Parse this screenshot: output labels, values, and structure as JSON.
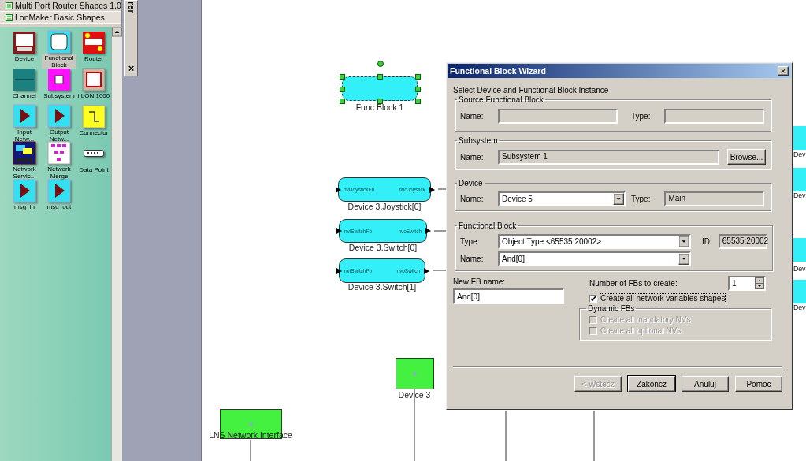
{
  "stencil": {
    "sections": [
      {
        "title": "Multi Port Router Shapes 1.0",
        "selected": false
      },
      {
        "title": "LonMaker Basic Shapes",
        "selected": true
      }
    ],
    "shapes": [
      {
        "label": "Device",
        "kind": "device",
        "selected": false
      },
      {
        "label": "Functional Block",
        "kind": "fb",
        "selected": true
      },
      {
        "label": "Router",
        "kind": "router",
        "selected": false
      },
      {
        "label": "Channel",
        "kind": "channel",
        "selected": false
      },
      {
        "label": "Subsystem",
        "kind": "subsystem",
        "selected": false
      },
      {
        "label": "i.LON 1000",
        "kind": "ilon",
        "selected": false
      },
      {
        "label": "Input Netw...",
        "kind": "input",
        "selected": false
      },
      {
        "label": "Output Netw...",
        "kind": "output",
        "selected": false
      },
      {
        "label": "Connector",
        "kind": "connector",
        "selected": false
      },
      {
        "label": "Network Servic...",
        "kind": "service",
        "selected": false
      },
      {
        "label": "Network Merge",
        "kind": "merge",
        "selected": false
      },
      {
        "label": "Data Point",
        "kind": "datapoint",
        "selected": false
      },
      {
        "label": "msg_in",
        "kind": "input",
        "selected": false
      },
      {
        "label": "msg_out",
        "kind": "output",
        "selected": false
      }
    ]
  },
  "dock": {
    "title": "rer",
    "close": "×"
  },
  "canvas": {
    "nodes": [
      {
        "kind": "block",
        "label": "Func Block 1",
        "selected": true
      },
      {
        "kind": "block",
        "label": "Device 3.Joystick[0]",
        "input": "nviJoystickFb",
        "output": "nvoJoystick",
        "selected": false
      },
      {
        "kind": "block",
        "label": "Device 3.Switch[0]",
        "input": "nviSwitchFb",
        "output": "nvoSwitch",
        "selected": false
      },
      {
        "kind": "block",
        "label": "Device 3.Switch[1]",
        "input": "nviSwitchFb",
        "output": "nvoSwitch",
        "selected": false
      },
      {
        "kind": "device",
        "label": "Device 3"
      },
      {
        "kind": "device",
        "label": "LNS Network Interface"
      },
      {
        "kind": "edge",
        "label": "Dev"
      },
      {
        "kind": "edge",
        "label": "Dev"
      },
      {
        "kind": "edge",
        "label": "Dev"
      },
      {
        "kind": "edge",
        "label": "Dev"
      }
    ]
  },
  "wizard": {
    "title": "Functional Block Wizard",
    "close": "×",
    "intro": "Select Device and Functional Block Instance",
    "source": {
      "title": "Source Functional Block",
      "name_label": "Name:",
      "type_label": "Type:"
    },
    "subsystem": {
      "title": "Subsystem",
      "name_label": "Name:",
      "name": "Subsystem 1",
      "browse": "Browse..."
    },
    "device": {
      "title": "Device",
      "name_label": "Name:",
      "name": "Device 5",
      "type_label": "Type:",
      "type": "Main"
    },
    "fb": {
      "title": "Functional Block",
      "type_label": "Type:",
      "type": "Object Type <65535:20002>",
      "id_label": "ID:",
      "id": "65535:20002",
      "name_label": "Name:",
      "name": "And[0]"
    },
    "new_name": {
      "label": "New FB name:",
      "value": "And[0]"
    },
    "count": {
      "label": "Number of FBs to create:",
      "value": "1"
    },
    "create_shapes": {
      "label": "Create all network variables shapes",
      "checked": true,
      "disabled": false
    },
    "dynamic": {
      "title": "Dynamic FBs",
      "options": [
        {
          "label": "Create all mandatory NVs",
          "checked": false,
          "disabled": true
        },
        {
          "label": "Create all optional NVs",
          "checked": false,
          "disabled": true
        }
      ]
    },
    "buttons": [
      {
        "label": "< Wstecz",
        "disabled": true,
        "default": false
      },
      {
        "label": "Zakończ",
        "disabled": false,
        "default": true
      },
      {
        "label": "Anuluj",
        "disabled": false,
        "default": false
      },
      {
        "label": "Pomoc",
        "disabled": false,
        "default": false
      }
    ]
  }
}
